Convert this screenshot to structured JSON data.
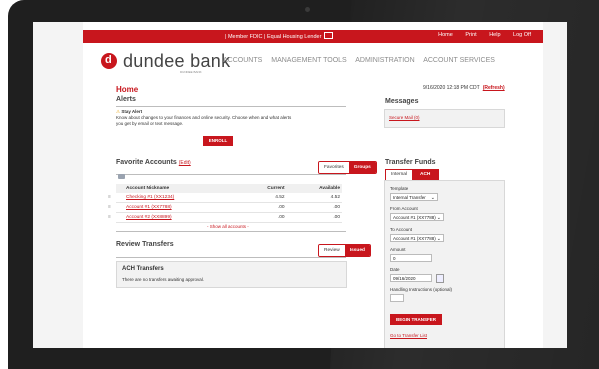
{
  "topbar": {
    "left_links": "| Member FDIC | Equal Housing Lender",
    "right_links": [
      "Home",
      "Print",
      "Help",
      "Log Off"
    ]
  },
  "brand": {
    "logo_letter": "d",
    "name": "dundee bank",
    "sub": "DUNDEE BANK"
  },
  "nav": [
    "ACCOUNTS",
    "MANAGEMENT TOOLS",
    "ADMINISTRATION",
    "ACCOUNT SERVICES"
  ],
  "datetime": {
    "text": "9/16/2020 12:18 PM CDT",
    "refresh": "(Refresh)"
  },
  "page_title": "Home",
  "alerts": {
    "title": "Alerts",
    "headline": "Stay Alert",
    "body_line1": "Know about changes to your finances and online security. Choose when and what alerts",
    "body_line2": "you get by email or text message.",
    "enroll": "ENROLL"
  },
  "messages": {
    "title": "Messages",
    "link": "Secure Mail (0)"
  },
  "favorites": {
    "title": "Favorite Accounts",
    "edit": "(Edit)",
    "tabs": [
      "Favorites",
      "Groups"
    ],
    "columns": [
      "Account Nickname",
      "Current",
      "Available"
    ],
    "rows": [
      {
        "name": "Checking #1 (XX1234)",
        "current": "4.52",
        "available": "4.52"
      },
      {
        "name": "Account #1 (XX7788)",
        "current": ".00",
        "available": ".00"
      },
      {
        "name": "Account #2 (XX8899)",
        "current": ".00",
        "available": ".00"
      }
    ],
    "show_all": "- Show all accounts -"
  },
  "review": {
    "title": "Review Transfers",
    "tabs": [
      "Review",
      "Issued"
    ],
    "box_title": "ACH Transfers",
    "box_text": "There are no transfers awaiting approval."
  },
  "transfer": {
    "title": "Transfer Funds",
    "tabs": [
      "Internal",
      "ACH"
    ],
    "template_label": "Template",
    "template_value": "Internal Transfer",
    "from_label": "From Account",
    "from_value": "Account #1 (XX7788)",
    "to_label": "To Account",
    "to_value": "Account #1 (XX7788)",
    "amount_label": "Amount",
    "amount_value": "0",
    "date_label": "Date",
    "date_value": "09/16/2020",
    "instructions_label": "Handling Instructions (optional)",
    "button": "BEGIN TRANSFER",
    "list_link": "Go to Transfer List"
  },
  "colors": {
    "brand_red": "#c8161d",
    "bezel": "#1f1f1f"
  }
}
